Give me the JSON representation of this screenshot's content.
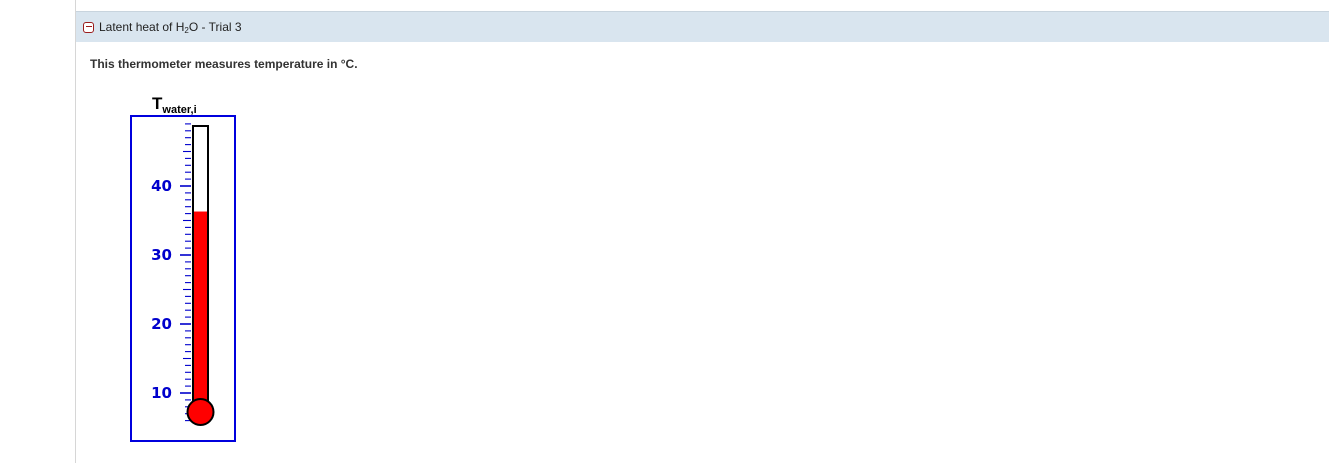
{
  "panel": {
    "title_prefix": "Latent heat of H",
    "title_subscript": "2",
    "title_suffix": "O - Trial 3",
    "collapse_icon": "minus-square-icon"
  },
  "description": "This thermometer measures temperature in °C.",
  "thermometer": {
    "label_main": "T",
    "label_sub": "water,i",
    "unit": "°C",
    "scale_min": 6,
    "scale_max": 49,
    "major_ticks": [
      10,
      20,
      30,
      40
    ],
    "minor_step": 1,
    "reading": 36.3,
    "colors": {
      "frame": "#0000dd",
      "ticks": "#0000cc",
      "mercury": "#ff0000",
      "tube": "#000000"
    }
  }
}
